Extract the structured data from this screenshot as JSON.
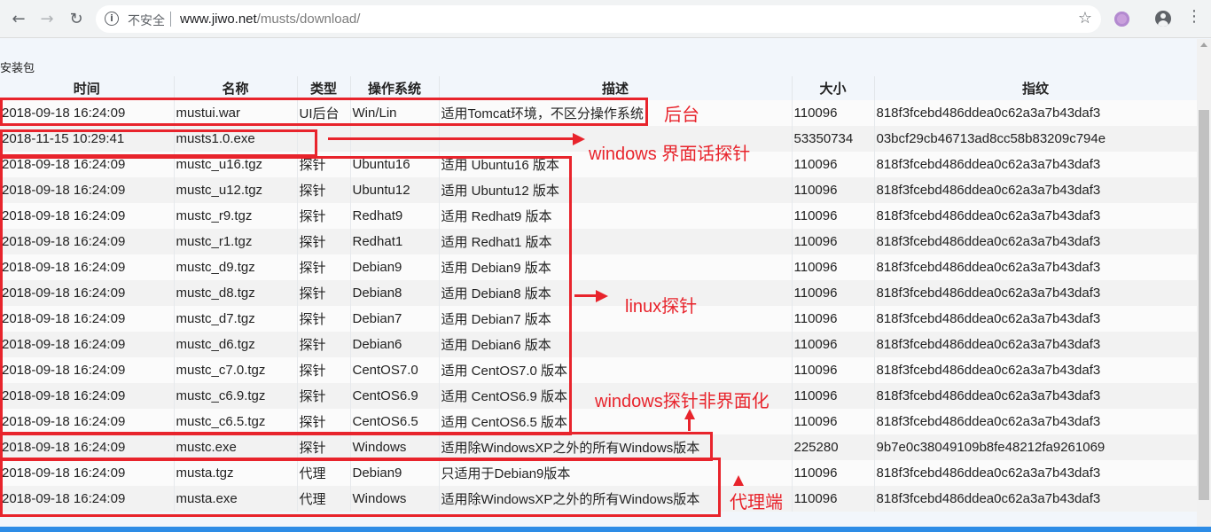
{
  "browser": {
    "nav_back_icon": "arrow-left-icon",
    "nav_forward_icon": "arrow-right-icon",
    "reload_icon": "reload-icon",
    "security_label": "不安全",
    "url_host": "www.jiwo.net",
    "url_path": "/musts/download/"
  },
  "page": {
    "section_title": "安装包",
    "columns": [
      "时间",
      "名称",
      "类型",
      "操作系统",
      "描述",
      "大小",
      "指纹"
    ],
    "rows": [
      {
        "time": "2018-09-18 16:24:09",
        "name": "mustui.war",
        "type": "UI后台",
        "os": "Win/Lin",
        "desc": "适用Tomcat环境，不区分操作系统",
        "size": "110096",
        "hash": "818f3fcebd486ddea0c62a3a7b43daf3"
      },
      {
        "time": "2018-11-15 10:29:41",
        "name": "musts1.0.exe",
        "type": "",
        "os": "",
        "desc": "",
        "size": "53350734",
        "hash": "03bcf29cb46713ad8cc58b83209c794e"
      },
      {
        "time": "2018-09-18 16:24:09",
        "name": "mustc_u16.tgz",
        "type": "探针",
        "os": "Ubuntu16",
        "desc": "适用 Ubuntu16 版本",
        "size": "110096",
        "hash": "818f3fcebd486ddea0c62a3a7b43daf3"
      },
      {
        "time": "2018-09-18 16:24:09",
        "name": "mustc_u12.tgz",
        "type": "探针",
        "os": "Ubuntu12",
        "desc": "适用 Ubuntu12 版本",
        "size": "110096",
        "hash": "818f3fcebd486ddea0c62a3a7b43daf3"
      },
      {
        "time": "2018-09-18 16:24:09",
        "name": "mustc_r9.tgz",
        "type": "探针",
        "os": "Redhat9",
        "desc": "适用 Redhat9 版本",
        "size": "110096",
        "hash": "818f3fcebd486ddea0c62a3a7b43daf3"
      },
      {
        "time": "2018-09-18 16:24:09",
        "name": "mustc_r1.tgz",
        "type": "探针",
        "os": "Redhat1",
        "desc": "适用 Redhat1 版本",
        "size": "110096",
        "hash": "818f3fcebd486ddea0c62a3a7b43daf3"
      },
      {
        "time": "2018-09-18 16:24:09",
        "name": "mustc_d9.tgz",
        "type": "探针",
        "os": "Debian9",
        "desc": "适用 Debian9 版本",
        "size": "110096",
        "hash": "818f3fcebd486ddea0c62a3a7b43daf3"
      },
      {
        "time": "2018-09-18 16:24:09",
        "name": "mustc_d8.tgz",
        "type": "探针",
        "os": "Debian8",
        "desc": "适用 Debian8 版本",
        "size": "110096",
        "hash": "818f3fcebd486ddea0c62a3a7b43daf3"
      },
      {
        "time": "2018-09-18 16:24:09",
        "name": "mustc_d7.tgz",
        "type": "探针",
        "os": "Debian7",
        "desc": "适用 Debian7 版本",
        "size": "110096",
        "hash": "818f3fcebd486ddea0c62a3a7b43daf3"
      },
      {
        "time": "2018-09-18 16:24:09",
        "name": "mustc_d6.tgz",
        "type": "探针",
        "os": "Debian6",
        "desc": "适用 Debian6 版本",
        "size": "110096",
        "hash": "818f3fcebd486ddea0c62a3a7b43daf3"
      },
      {
        "time": "2018-09-18 16:24:09",
        "name": "mustc_c7.0.tgz",
        "type": "探针",
        "os": "CentOS7.0",
        "desc": "适用 CentOS7.0 版本",
        "size": "110096",
        "hash": "818f3fcebd486ddea0c62a3a7b43daf3"
      },
      {
        "time": "2018-09-18 16:24:09",
        "name": "mustc_c6.9.tgz",
        "type": "探针",
        "os": "CentOS6.9",
        "desc": "适用 CentOS6.9 版本",
        "size": "110096",
        "hash": "818f3fcebd486ddea0c62a3a7b43daf3"
      },
      {
        "time": "2018-09-18 16:24:09",
        "name": "mustc_c6.5.tgz",
        "type": "探针",
        "os": "CentOS6.5",
        "desc": "适用 CentOS6.5 版本",
        "size": "110096",
        "hash": "818f3fcebd486ddea0c62a3a7b43daf3"
      },
      {
        "time": "2018-09-18 16:24:09",
        "name": "mustc.exe",
        "type": "探针",
        "os": "Windows",
        "desc": "适用除WindowsXP之外的所有Windows版本",
        "size": "225280",
        "hash": "9b7e0c38049109b8fe48212fa9261069"
      },
      {
        "time": "2018-09-18 16:24:09",
        "name": "musta.tgz",
        "type": "代理",
        "os": "Debian9",
        "desc": "只适用于Debian9版本",
        "size": "110096",
        "hash": "818f3fcebd486ddea0c62a3a7b43daf3"
      },
      {
        "time": "2018-09-18 16:24:09",
        "name": "musta.exe",
        "type": "代理",
        "os": "Windows",
        "desc": "适用除WindowsXP之外的所有Windows版本",
        "size": "110096",
        "hash": "818f3fcebd486ddea0c62a3a7b43daf3"
      }
    ]
  },
  "annotations": {
    "backend": "后台",
    "windows_gui_probe": "windows 界面话探针",
    "linux_probe": "linux探针",
    "windows_cli_probe": "windows探针非界面化",
    "proxy": "代理端",
    "color": "#e8242c"
  }
}
